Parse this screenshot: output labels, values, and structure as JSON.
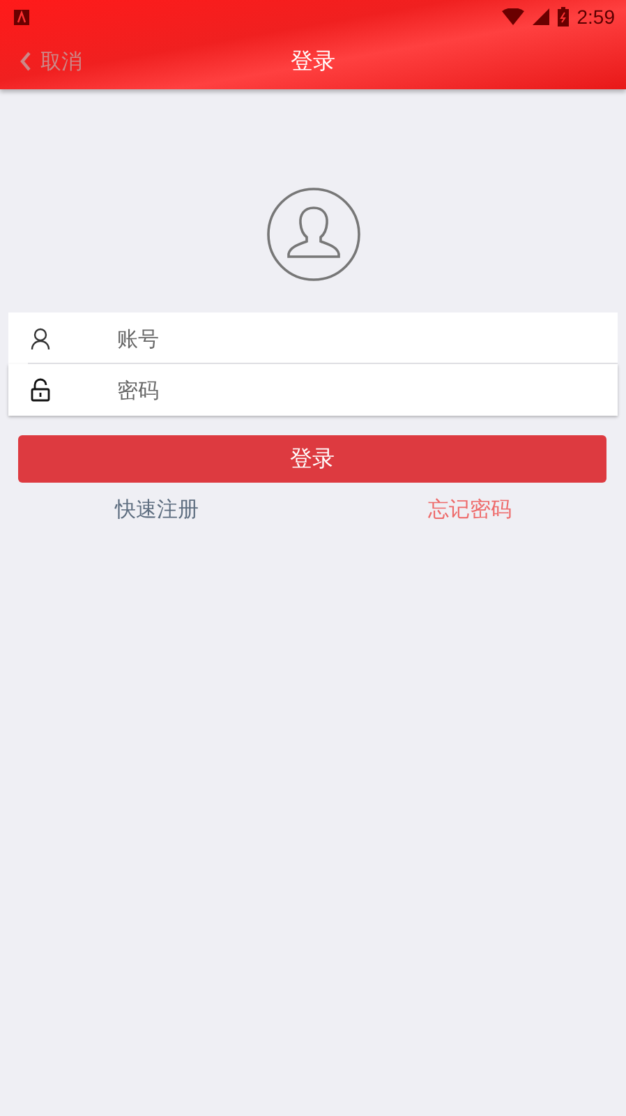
{
  "status_bar": {
    "time": "2:59"
  },
  "header": {
    "back_label": "取消",
    "title": "登录"
  },
  "form": {
    "fields": [
      {
        "kind": "account",
        "placeholder": "账号"
      },
      {
        "kind": "password",
        "placeholder": "密码"
      }
    ]
  },
  "login_button": "登录",
  "links": [
    {
      "label": "快速注册",
      "kind": "register"
    },
    {
      "label": "忘记密码",
      "kind": "forgot"
    }
  ]
}
